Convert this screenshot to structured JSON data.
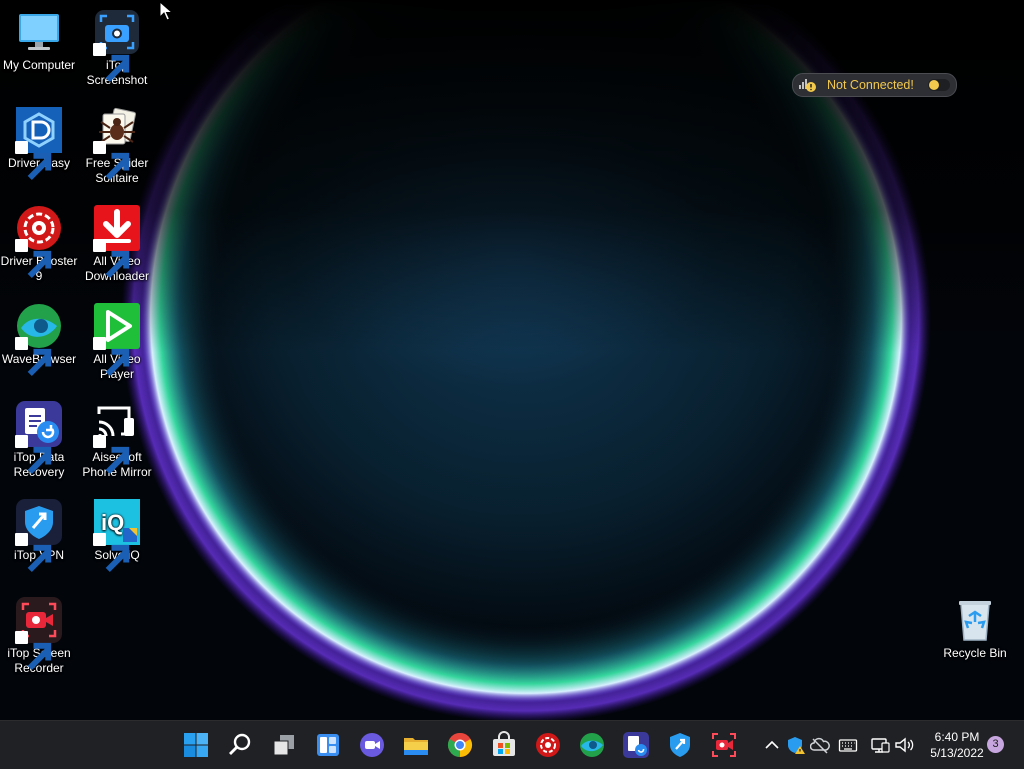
{
  "desktop": {
    "icons": [
      {
        "label": "My Computer",
        "icon": "computer-icon"
      },
      {
        "label": "iTop Screenshot",
        "icon": "camera-icon"
      },
      {
        "label": "Driver Easy",
        "icon": "driver-easy-icon"
      },
      {
        "label": "Free Spider Solitaire",
        "icon": "spider-cards-icon"
      },
      {
        "label": "Driver Booster 9",
        "icon": "driver-booster-icon"
      },
      {
        "label": "All Video Downloader",
        "icon": "download-arrow-icon"
      },
      {
        "label": "WaveBrowser",
        "icon": "wave-browser-icon"
      },
      {
        "label": "All Video Player",
        "icon": "play-icon"
      },
      {
        "label": "iTop Data Recovery",
        "icon": "data-recovery-icon"
      },
      {
        "label": "Aiseesoft Phone Mirror",
        "icon": "cast-icon"
      },
      {
        "label": "iTop VPN",
        "icon": "vpn-shield-icon"
      },
      {
        "label": "Solve iQ",
        "icon": "solve-iq-icon"
      },
      {
        "label": "iTop Screen Recorder",
        "icon": "screen-recorder-icon"
      },
      {
        "label": "Recycle Bin",
        "icon": "recycle-bin-icon"
      }
    ]
  },
  "vpn_widget": {
    "status": "Not Connected!",
    "status_color": "#f2c94c"
  },
  "taskbar": {
    "pinned": [
      "start-icon",
      "search-icon",
      "task-view-icon",
      "widgets-icon",
      "chat-icon",
      "file-explorer-icon",
      "chrome-icon",
      "store-icon",
      "driver-booster-icon",
      "wave-browser-icon",
      "data-recovery-icon",
      "vpn-shield-icon",
      "screen-recorder-icon"
    ],
    "tray": [
      "chevron-up-icon",
      "security-warning-icon",
      "cloud-offline-icon",
      "keyboard-icon",
      "network-icon",
      "volume-icon"
    ],
    "clock": {
      "time": "6:40 PM",
      "date": "5/13/2022"
    },
    "notifications": "3"
  },
  "colors": {
    "taskbar_bg": "#202124",
    "accent_blue": "#2aa0f0"
  }
}
